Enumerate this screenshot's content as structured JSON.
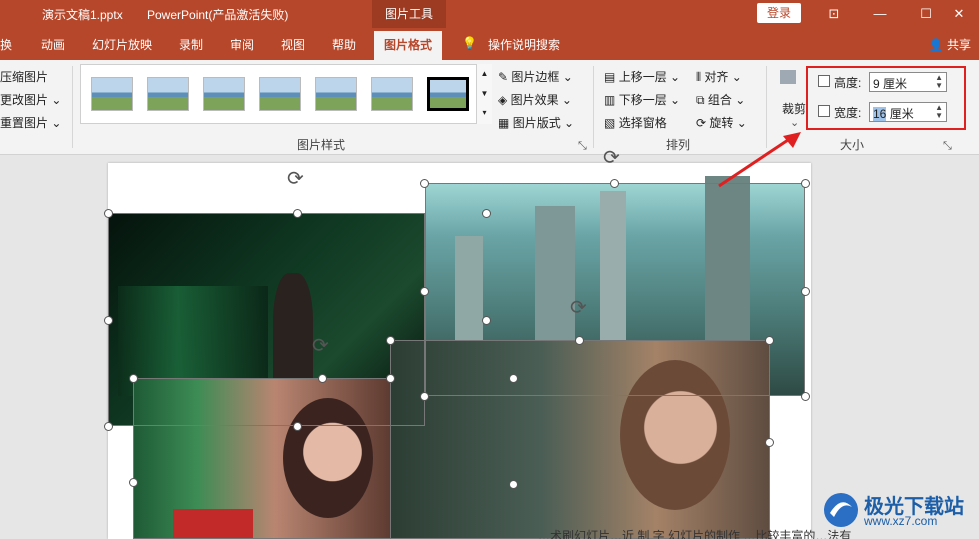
{
  "titlebar": {
    "doc_name": "演示文稿1.pptx",
    "app_name": "PowerPoint(产品激活失败)",
    "context_tab": "图片工具",
    "login": "登录"
  },
  "tabs": [
    {
      "label": "换"
    },
    {
      "label": "动画"
    },
    {
      "label": "幻灯片放映"
    },
    {
      "label": "录制"
    },
    {
      "label": "审阅"
    },
    {
      "label": "视图"
    },
    {
      "label": "帮助"
    },
    {
      "label": "图片格式"
    }
  ],
  "active_tab": "图片格式",
  "tell_me": "操作说明搜索",
  "share": "共享",
  "adjust": {
    "compress": "压缩图片",
    "change": "更改图片",
    "reset": "重置图片"
  },
  "styles_group": {
    "label": "图片样式"
  },
  "picture_opts": {
    "border": "图片边框",
    "effects": "图片效果",
    "layout": "图片版式"
  },
  "arrange": {
    "bring_forward": "上移一层",
    "send_backward": "下移一层",
    "selection_pane": "选择窗格",
    "align": "对齐",
    "group": "组合",
    "rotate": "旋转",
    "label": "排列"
  },
  "size": {
    "crop": "裁剪",
    "height_label": "高度:",
    "height_value": "9 厘米",
    "width_label": "宽度:",
    "width_value_sel": "16",
    "width_value_rest": " 厘米",
    "label": "大小"
  },
  "watermark": {
    "name": "极光下载站",
    "url": "www.xz7.com"
  },
  "bottom_text": "…术刷幻灯片…近 制 字 幻灯片的制作 …比较丰富的…法有"
}
